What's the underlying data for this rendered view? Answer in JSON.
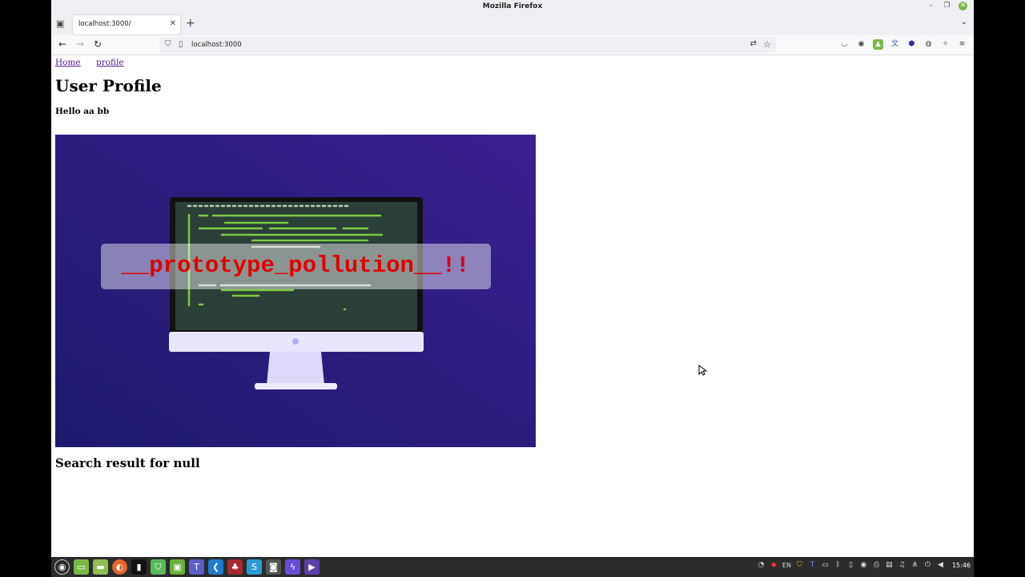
{
  "window": {
    "title": "Mozilla Firefox"
  },
  "tab": {
    "title": "localhost:3000/"
  },
  "url": {
    "value": "localhost:3000"
  },
  "page": {
    "nav_links": [
      "Home",
      "profile"
    ],
    "title": "User Profile",
    "greeting": "Hello aa bb",
    "hero_text": "__prototype_pollution__!!",
    "search_result": "Search result for null"
  },
  "taskbar": {
    "lang": "EN",
    "time": "15:46"
  },
  "colors": {
    "hero_bg": "#2a1d7a",
    "hero_text": "#e00000",
    "code_green": "#7ec845"
  }
}
